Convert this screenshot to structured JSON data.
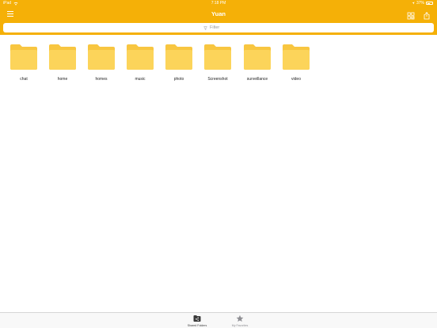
{
  "status_bar": {
    "device": "iPad",
    "time": "7:18 PM",
    "battery": "37%"
  },
  "header": {
    "title": "Yuan",
    "menu_icon": "hamburger-menu-icon",
    "grid_icon": "grid-select-icon",
    "share_icon": "share-icon"
  },
  "filter": {
    "placeholder": "Filter",
    "value": ""
  },
  "folders": [
    {
      "label": "chat"
    },
    {
      "label": "home"
    },
    {
      "label": "homes"
    },
    {
      "label": "music"
    },
    {
      "label": "photo"
    },
    {
      "label": "Screenshot"
    },
    {
      "label": "surveillance"
    },
    {
      "label": "video"
    }
  ],
  "tabs": [
    {
      "label": "Shared Folders",
      "icon": "shared-folder-icon",
      "active": true
    },
    {
      "label": "My Favorites",
      "icon": "star-icon",
      "active": false
    }
  ],
  "colors": {
    "accent": "#f5b007",
    "folder": "#f8c640",
    "folder_front": "#fcd45a",
    "tab_active": "#3a3a3a",
    "tab_inactive": "#8e8e93"
  }
}
